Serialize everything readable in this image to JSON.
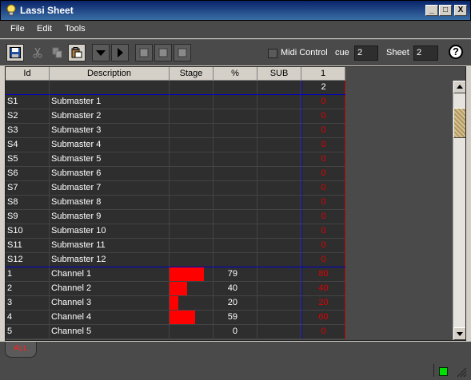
{
  "window": {
    "title": "Lassi Sheet",
    "minimize": "_",
    "maximize": "□",
    "close": "X"
  },
  "menu": {
    "items": [
      "File",
      "Edit",
      "Tools"
    ]
  },
  "toolbar": {
    "midi_label": "Midi Control",
    "cue_label": "cue",
    "cue_value": "2",
    "sheet_label": "Sheet",
    "sheet_value": "2",
    "help_label": "?"
  },
  "table": {
    "headers": [
      "Id",
      "Description",
      "Stage",
      "%",
      "SUB",
      "1"
    ],
    "cue_number_row": "2",
    "rows": [
      {
        "id": "S1",
        "description": "Submaster 1",
        "stage": 0,
        "percent": "",
        "sub": "",
        "cue": "0"
      },
      {
        "id": "S2",
        "description": "Submaster 2",
        "stage": 0,
        "percent": "",
        "sub": "",
        "cue": "0"
      },
      {
        "id": "S3",
        "description": "Submaster 3",
        "stage": 0,
        "percent": "",
        "sub": "",
        "cue": "0"
      },
      {
        "id": "S4",
        "description": "Submaster 4",
        "stage": 0,
        "percent": "",
        "sub": "",
        "cue": "0"
      },
      {
        "id": "S5",
        "description": "Submaster 5",
        "stage": 0,
        "percent": "",
        "sub": "",
        "cue": "0"
      },
      {
        "id": "S6",
        "description": "Submaster 6",
        "stage": 0,
        "percent": "",
        "sub": "",
        "cue": "0"
      },
      {
        "id": "S7",
        "description": "Submaster 7",
        "stage": 0,
        "percent": "",
        "sub": "",
        "cue": "0"
      },
      {
        "id": "S8",
        "description": "Submaster 8",
        "stage": 0,
        "percent": "",
        "sub": "",
        "cue": "0"
      },
      {
        "id": "S9",
        "description": "Submaster 9",
        "stage": 0,
        "percent": "",
        "sub": "",
        "cue": "0"
      },
      {
        "id": "S10",
        "description": "Submaster 10",
        "stage": 0,
        "percent": "",
        "sub": "",
        "cue": "0"
      },
      {
        "id": "S11",
        "description": "Submaster 11",
        "stage": 0,
        "percent": "",
        "sub": "",
        "cue": "0"
      },
      {
        "id": "S12",
        "description": "Submaster 12",
        "stage": 0,
        "percent": "",
        "sub": "",
        "cue": "0"
      },
      {
        "id": "1",
        "description": "Channel 1",
        "stage": 79,
        "percent": "79",
        "sub": "",
        "cue": "80"
      },
      {
        "id": "2",
        "description": "Channel 2",
        "stage": 40,
        "percent": "40",
        "sub": "",
        "cue": "40"
      },
      {
        "id": "3",
        "description": "Channel 3",
        "stage": 20,
        "percent": "20",
        "sub": "",
        "cue": "20"
      },
      {
        "id": "4",
        "description": "Channel 4",
        "stage": 59,
        "percent": "59",
        "sub": "",
        "cue": "60"
      },
      {
        "id": "5",
        "description": "Channel 5",
        "stage": 0,
        "percent": "0",
        "sub": "",
        "cue": "0"
      }
    ]
  },
  "tabs": [
    {
      "label": "ALL"
    }
  ],
  "colors": {
    "stage_bar": "#ff0000",
    "cue_value": "#e00000",
    "status_led": "#00e000"
  }
}
